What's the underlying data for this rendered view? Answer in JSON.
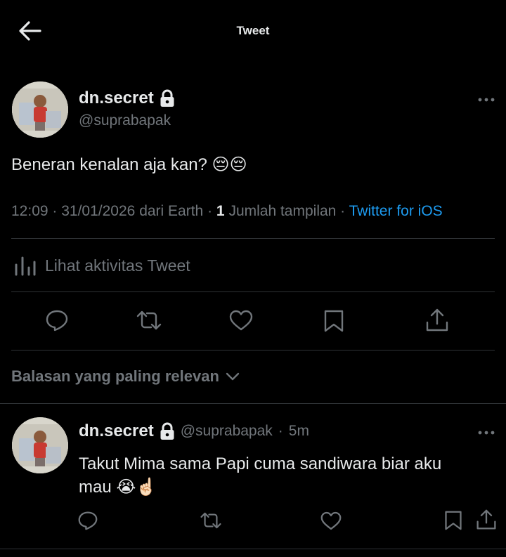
{
  "header": {
    "title": "Tweet"
  },
  "tweet": {
    "name": "dn.secret",
    "handle": "@suprabapak",
    "text": "Beneran kenalan aja kan? 😔😔",
    "time": "12:09",
    "date": "31/01/2026",
    "source_prefix": "dari Earth",
    "views_count": "1",
    "views_label": "Jumlah tampilan",
    "client": "Twitter for iOS",
    "activity_label": "Lihat aktivitas Tweet"
  },
  "replies_sort": {
    "label": "Balasan yang paling relevan"
  },
  "reply": {
    "name": "dn.secret",
    "handle": "@suprabapak",
    "age": "5m",
    "text": "Takut Mima sama Papi cuma sandiwara biar aku mau 😭☝🏻"
  },
  "icons": {
    "back": "arrow-left-icon",
    "lock": "lock-icon",
    "more": "more-icon",
    "activity": "bar-chart-icon",
    "reply": "reply-icon",
    "retweet": "retweet-icon",
    "like": "heart-icon",
    "bookmark": "bookmark-icon",
    "share": "share-icon",
    "chevron": "chevron-down-icon"
  },
  "colors": {
    "background": "#000000",
    "text": "#e7e9ea",
    "muted": "#71767b",
    "link": "#1d9bf0",
    "divider": "#2f3336"
  }
}
